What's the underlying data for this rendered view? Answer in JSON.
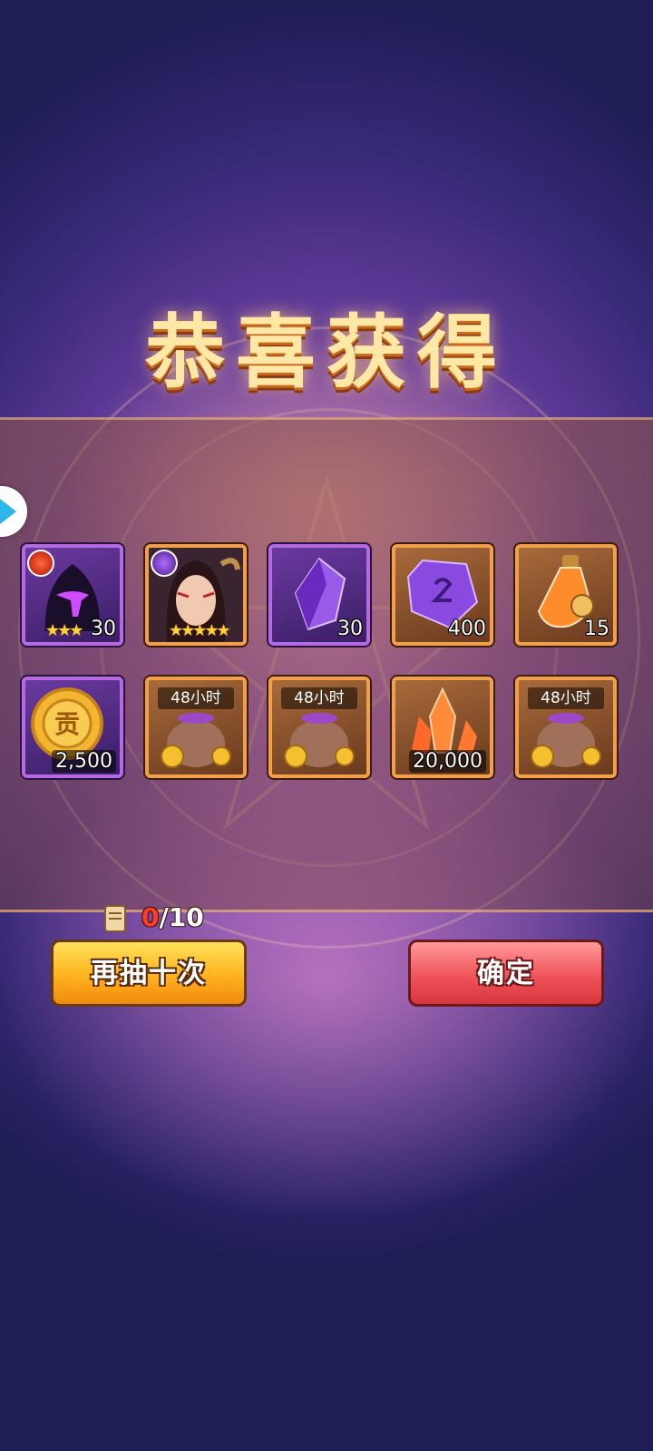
{
  "title": "恭喜获得",
  "items": [
    {
      "name": "shadow-hero-card",
      "quantity": "30",
      "stars": "★★★",
      "icon": "hooded-shadow-icon"
    },
    {
      "name": "demon-hero-card",
      "quantity": "",
      "stars": "★★★★★",
      "icon": "demon-portrait-icon"
    },
    {
      "name": "purple-crystal",
      "quantity": "30",
      "icon": "purple-crystal-icon"
    },
    {
      "name": "purple-gem",
      "quantity": "400",
      "icon": "purple-gem-icon"
    },
    {
      "name": "orange-potion",
      "quantity": "15",
      "icon": "potion-icon"
    },
    {
      "name": "contribution-coin",
      "quantity": "2,500",
      "icon": "coin-icon",
      "coin_glyph": "贡"
    },
    {
      "name": "gold-bag-1",
      "duration": "48小时",
      "icon": "gold-bag-icon"
    },
    {
      "name": "gold-bag-2",
      "duration": "48小时",
      "icon": "gold-bag-icon"
    },
    {
      "name": "orange-crystal",
      "quantity": "20,000",
      "icon": "orange-crystal-icon"
    },
    {
      "name": "gold-bag-3",
      "duration": "48小时",
      "icon": "gold-bag-icon"
    }
  ],
  "counter": {
    "current": "0",
    "total": "/10"
  },
  "buttons": {
    "draw_again": "再抽十次",
    "confirm": "确定"
  },
  "colors": {
    "title": "#ffe7a6",
    "draw_button": "#ffb21e",
    "confirm_button": "#f0535a"
  }
}
